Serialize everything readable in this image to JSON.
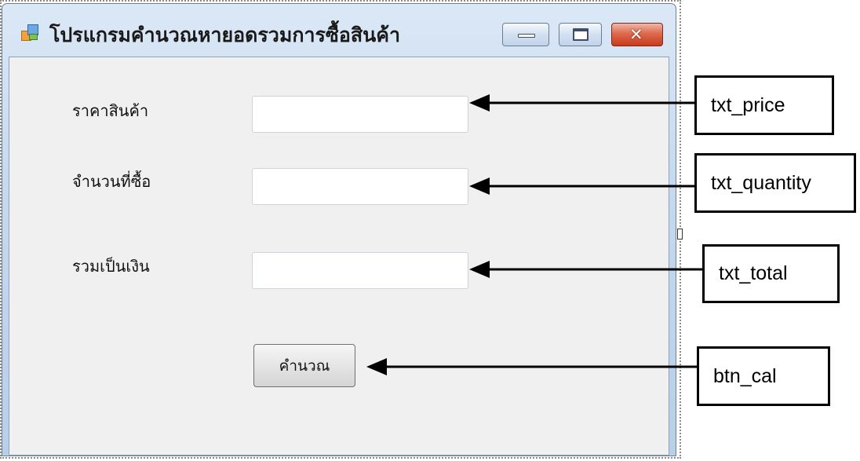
{
  "window": {
    "title": "โปรแกรมคำนวณหายอดรวมการซื้อสินค้า",
    "close_glyph": "✕"
  },
  "form": {
    "price_label": "ราคาสินค้า",
    "quantity_label": "จำนวนที่ซื้อ",
    "total_label": "รวมเป็นเงิน",
    "price_value": "",
    "quantity_value": "",
    "total_value": "",
    "calculate_button": "คำนวณ"
  },
  "callouts": {
    "price": "txt_price",
    "quantity": "txt_quantity",
    "total": "txt_total",
    "button": "btn_cal"
  },
  "icons": {
    "app": "app-icon",
    "minimize": "minimize-icon",
    "maximize": "maximize-icon",
    "close": "close-icon",
    "arrow": "arrow-left-icon"
  }
}
